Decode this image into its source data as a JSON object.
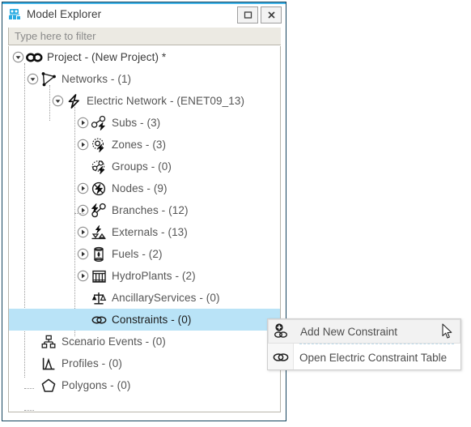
{
  "window": {
    "title": "Model Explorer",
    "icon": "model-explorer-icon",
    "accent_color": "#3fb3e8",
    "border_color": "#16455e",
    "buttons": [
      {
        "name": "maximize-button",
        "icon": "maximize-icon",
        "label": ""
      },
      {
        "name": "close-button",
        "icon": "close-icon",
        "label": ""
      }
    ]
  },
  "filter": {
    "placeholder": "Type here to filter",
    "value": ""
  },
  "tree": {
    "selection_color": "#b9e3f7",
    "items": [
      {
        "label": "Project - (New Project) *",
        "icon": "infinity-icon",
        "depth": 0,
        "twisty": "expanded"
      },
      {
        "label": "Networks - (1)",
        "icon": "networks-icon",
        "depth": 1,
        "twisty": "expanded"
      },
      {
        "label": "Electric Network - (ENET09_13)",
        "icon": "bolt-icon",
        "depth": 2,
        "twisty": "expanded"
      },
      {
        "label": "Subs - (3)",
        "icon": "subs-icon",
        "depth": 3,
        "twisty": "collapsed"
      },
      {
        "label": "Zones - (3)",
        "icon": "zones-icon",
        "depth": 3,
        "twisty": "collapsed"
      },
      {
        "label": "Groups - (0)",
        "icon": "groups-icon",
        "depth": 3,
        "twisty": "none"
      },
      {
        "label": "Nodes - (9)",
        "icon": "nodes-icon",
        "depth": 3,
        "twisty": "collapsed"
      },
      {
        "label": "Branches - (12)",
        "icon": "branches-icon",
        "depth": 3,
        "twisty": "collapsed"
      },
      {
        "label": "Externals - (13)",
        "icon": "externals-icon",
        "depth": 3,
        "twisty": "collapsed"
      },
      {
        "label": "Fuels - (2)",
        "icon": "fuels-icon",
        "depth": 3,
        "twisty": "collapsed"
      },
      {
        "label": "HydroPlants - (2)",
        "icon": "hydroplants-icon",
        "depth": 3,
        "twisty": "collapsed"
      },
      {
        "label": "AncillaryServices - (0)",
        "icon": "ancillaryservices-icon",
        "depth": 3,
        "twisty": "none"
      },
      {
        "label": "Constraints - (0)",
        "icon": "constraints-icon",
        "depth": 3,
        "twisty": "none",
        "selected": true
      },
      {
        "label": "Scenario Events - (0)",
        "icon": "scenario-events-icon",
        "depth": 1,
        "twisty": "none"
      },
      {
        "label": "Profiles - (0)",
        "icon": "profiles-icon",
        "depth": 1,
        "twisty": "none"
      },
      {
        "label": "Polygons - (0)",
        "icon": "polygons-icon",
        "depth": 1,
        "twisty": "none"
      }
    ]
  },
  "context_menu": {
    "items": [
      {
        "label": "Add New Constraint",
        "icon": "add-constraint-icon",
        "hovered": true
      },
      {
        "label": "Open Electric Constraint Table",
        "icon": "constraint-table-icon",
        "hovered": false
      }
    ]
  },
  "cursor": {
    "icon": "arrow-cursor"
  }
}
